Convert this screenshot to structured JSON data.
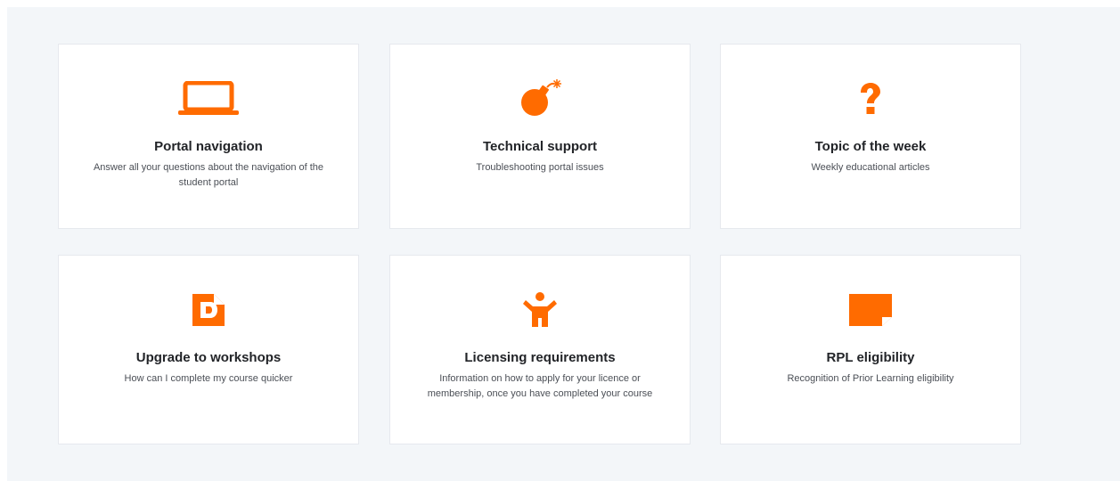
{
  "accent_color": "#ff6b00",
  "background_color": "#f3f6f9",
  "cards": [
    {
      "icon": "laptop-icon",
      "title": "Portal navigation",
      "description": "Answer all your questions about the navigation of the student portal"
    },
    {
      "icon": "bomb-icon",
      "title": "Technical support",
      "description": "Troubleshooting portal issues"
    },
    {
      "icon": "question-mark-icon",
      "title": "Topic of the week",
      "description": "Weekly educational articles"
    },
    {
      "icon": "document-icon",
      "title": "Upgrade to workshops",
      "description": "How can I complete my course quicker"
    },
    {
      "icon": "person-icon",
      "title": "Licensing requirements",
      "description": "Information on how to apply for your licence or membership, once you have completed your course"
    },
    {
      "icon": "sticky-note-icon",
      "title": "RPL eligibility",
      "description": "Recognition of Prior Learning eligibility"
    }
  ]
}
